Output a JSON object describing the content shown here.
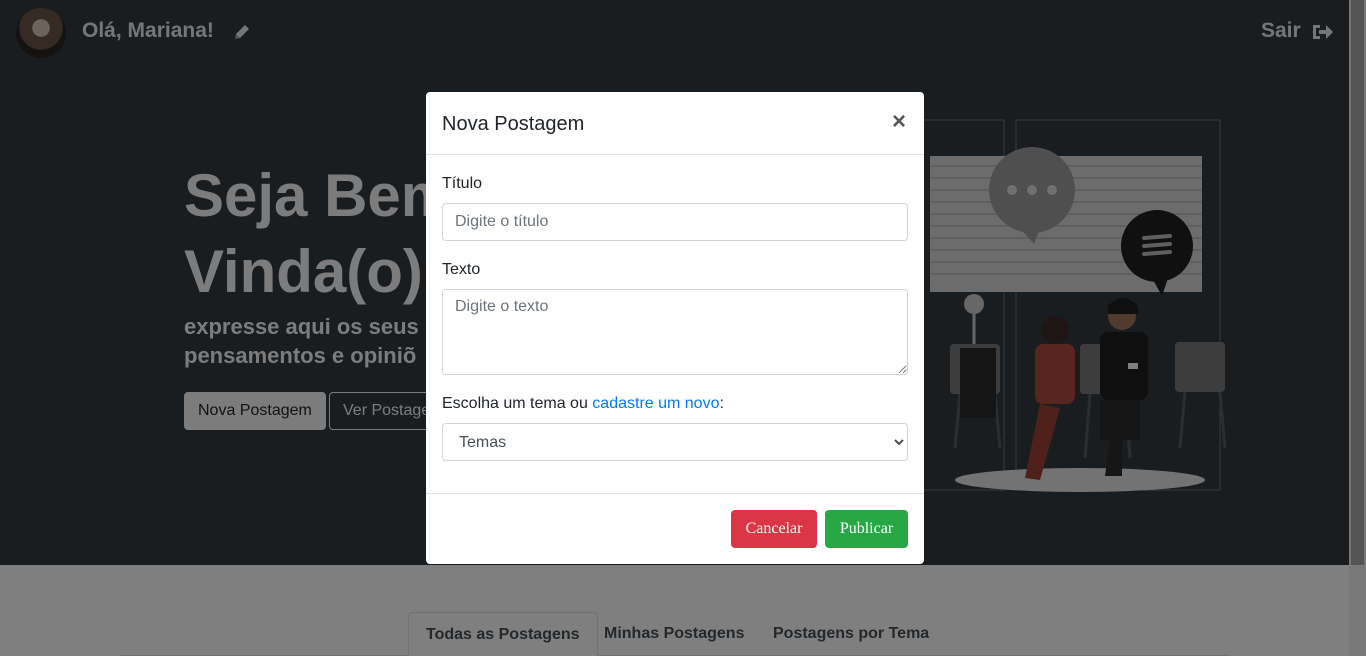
{
  "header": {
    "greeting": "Olá, Mariana!",
    "logout_label": "Sair"
  },
  "hero": {
    "title_line1": "Seja Bem",
    "title_line2": "Vinda(o)",
    "subtitle_line1": "expresse aqui os seus",
    "subtitle_line2": "pensamentos e opiniõ",
    "new_post_button": "Nova Postagem",
    "view_posts_button": "Ver Postage"
  },
  "tabs": [
    {
      "label": "Todas as Postagens"
    },
    {
      "label": "Minhas Postagens"
    },
    {
      "label": "Postagens por Tema"
    }
  ],
  "modal": {
    "title": "Nova Postagem",
    "close_symbol": "×",
    "title_label": "Título",
    "title_placeholder": "Digite o título",
    "text_label": "Texto",
    "text_placeholder": "Digite o texto",
    "theme_label_prefix": "Escolha um tema ou ",
    "theme_link": "cadastre um novo",
    "theme_label_suffix": ":",
    "theme_select_value": "Temas",
    "cancel_button": "Cancelar",
    "publish_button": "Publicar"
  },
  "colors": {
    "hero_bg": "#343a40",
    "cancel": "#dc3545",
    "publish": "#28a745",
    "link": "#007bff"
  },
  "icons": [
    "pencil-icon",
    "sign-out-icon",
    "close-icon",
    "chevron-down-icon"
  ]
}
